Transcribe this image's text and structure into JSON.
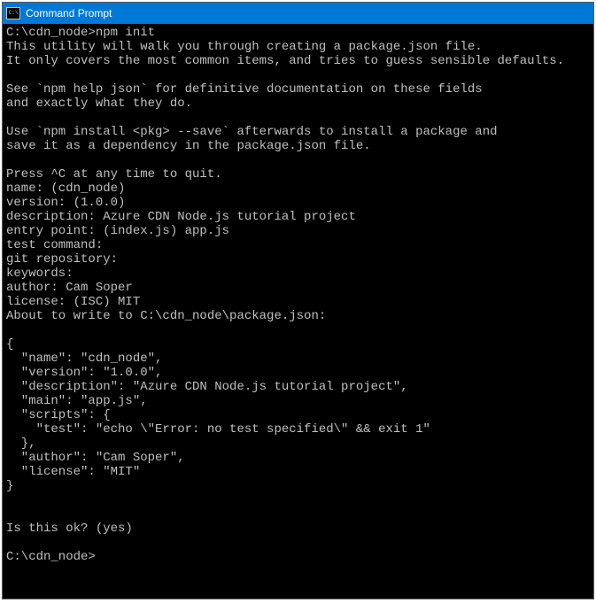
{
  "window": {
    "title": "Command Prompt"
  },
  "terminal": {
    "prompt1": "C:\\cdn_node>npm init",
    "intro1": "This utility will walk you through creating a package.json file.",
    "intro2": "It only covers the most common items, and tries to guess sensible defaults.",
    "blank1": "",
    "help1": "See `npm help json` for definitive documentation on these fields",
    "help2": "and exactly what they do.",
    "blank2": "",
    "install1": "Use `npm install <pkg> --save` afterwards to install a package and",
    "install2": "save it as a dependency in the package.json file.",
    "blank3": "",
    "quit": "Press ^C at any time to quit.",
    "q_name": "name: (cdn_node)",
    "q_version": "version: (1.0.0)",
    "q_description": "description: Azure CDN Node.js tutorial project",
    "q_entry": "entry point: (index.js) app.js",
    "q_test": "test command:",
    "q_git": "git repository:",
    "q_keywords": "keywords:",
    "q_author": "author: Cam Soper",
    "q_license": "license: (ISC) MIT",
    "about": "About to write to C:\\cdn_node\\package.json:",
    "blank4": "",
    "json_open": "{",
    "json_name": "  \"name\": \"cdn_node\",",
    "json_version": "  \"version\": \"1.0.0\",",
    "json_desc": "  \"description\": \"Azure CDN Node.js tutorial project\",",
    "json_main": "  \"main\": \"app.js\",",
    "json_scripts": "  \"scripts\": {",
    "json_test": "    \"test\": \"echo \\\"Error: no test specified\\\" && exit 1\"",
    "json_scripts_close": "  },",
    "json_author": "  \"author\": \"Cam Soper\",",
    "json_license": "  \"license\": \"MIT\"",
    "json_close": "}",
    "blank5": "",
    "blank6": "",
    "ok": "Is this ok? (yes)",
    "blank7": "",
    "prompt2": "C:\\cdn_node>"
  }
}
